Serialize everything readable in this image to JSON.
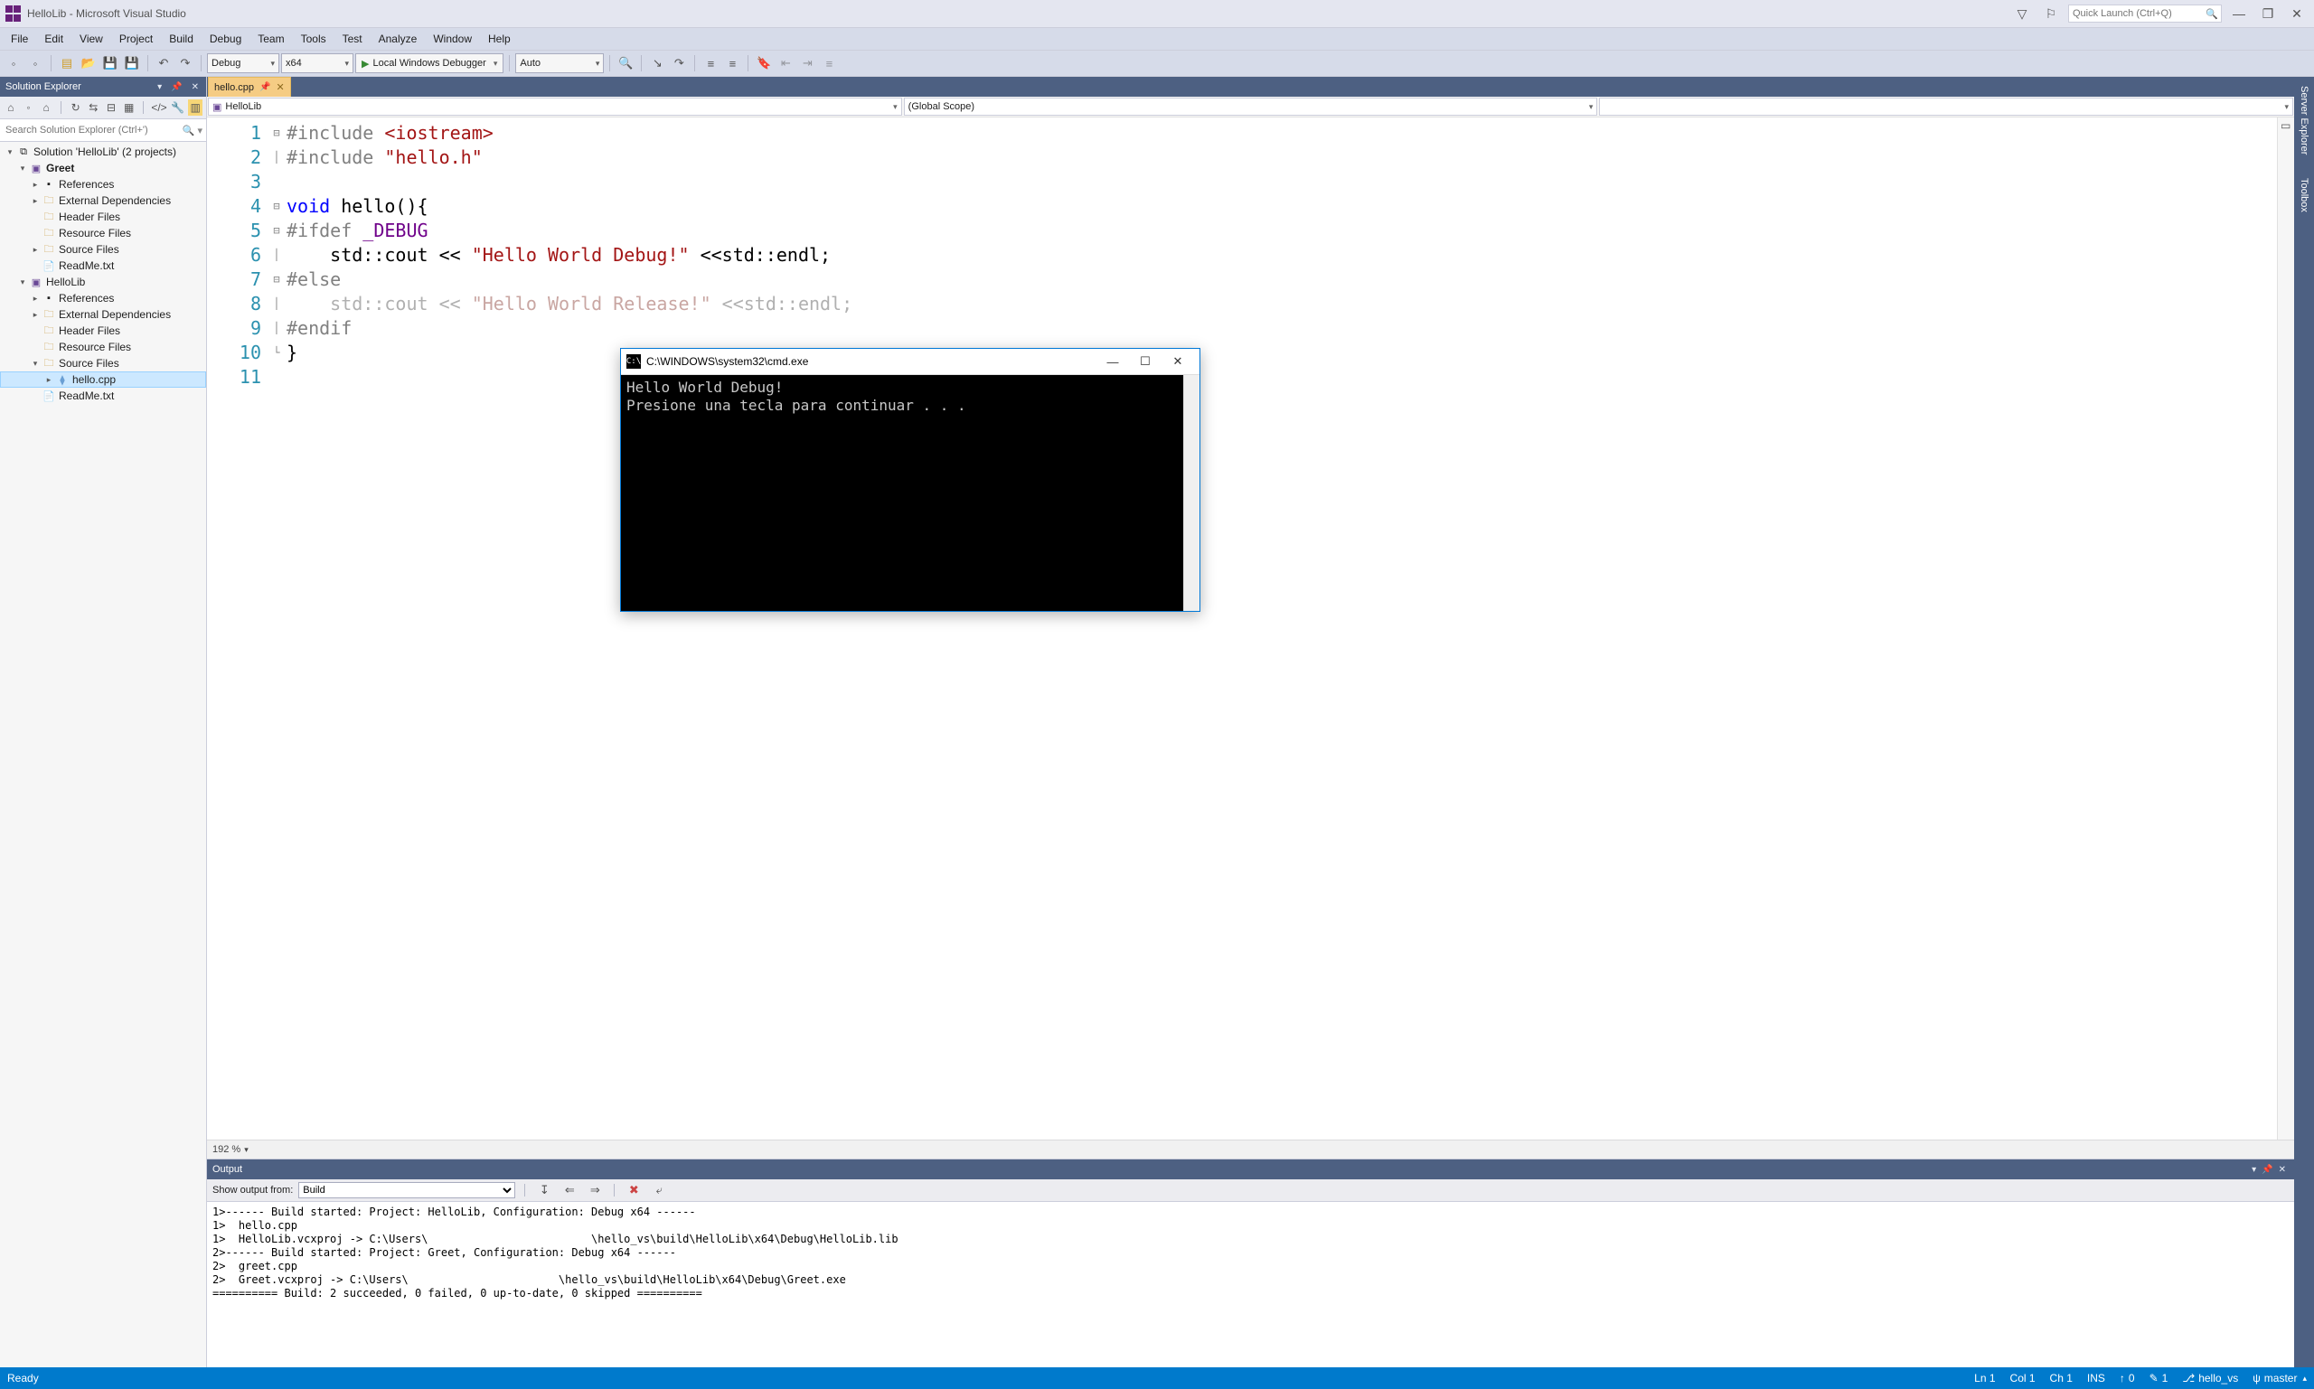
{
  "window": {
    "title": "HelloLib - Microsoft Visual Studio"
  },
  "quicklaunch": {
    "placeholder": "Quick Launch (Ctrl+Q)"
  },
  "menu": [
    "File",
    "Edit",
    "View",
    "Project",
    "Build",
    "Debug",
    "Team",
    "Tools",
    "Test",
    "Analyze",
    "Window",
    "Help"
  ],
  "toolbar": {
    "config": "Debug",
    "platform": "x64",
    "debugger": "Local Windows Debugger",
    "auto": "Auto"
  },
  "solution_explorer": {
    "title": "Solution Explorer",
    "search_placeholder": "Search Solution Explorer (Ctrl+')",
    "root": "Solution 'HelloLib' (2 projects)",
    "projects": [
      {
        "name": "Greet",
        "bold": true,
        "items": [
          "References",
          "External Dependencies",
          "Header Files",
          "Resource Files",
          "Source Files",
          "ReadMe.txt"
        ]
      },
      {
        "name": "HelloLib",
        "items": [
          "References",
          "External Dependencies",
          "Header Files",
          "Resource Files"
        ],
        "sources": {
          "folder": "Source Files",
          "files": [
            "hello.cpp"
          ],
          "after": [
            "ReadMe.txt"
          ]
        }
      }
    ]
  },
  "editor": {
    "tab": "hello.cpp",
    "nav_left": "HelloLib",
    "nav_right": "(Global Scope)",
    "zoom": "192 %",
    "lines": [
      1,
      2,
      3,
      4,
      5,
      6,
      7,
      8,
      9,
      10,
      11
    ],
    "code": {
      "l1_a": "#include",
      "l1_b": "<iostream>",
      "l2_a": "#include",
      "l2_b": "\"hello.h\"",
      "l4_a": "void",
      "l4_b": " hello(){",
      "l5_a": "#ifdef",
      "l5_b": "_DEBUG",
      "l6_b": "    std::cout << ",
      "l6_s": "\"Hello World Debug!\"",
      "l6_c": " <<std::endl;",
      "l7": "#else",
      "l8_b": "    std::cout << ",
      "l8_s": "\"Hello World Release!\"",
      "l8_c": " <<std::endl;",
      "l9": "#endif",
      "l10": "}"
    }
  },
  "right_tabs": [
    "Server Explorer",
    "Toolbox"
  ],
  "output": {
    "title": "Output",
    "show_from_label": "Show output from:",
    "show_from_value": "Build",
    "text": "1>------ Build started: Project: HelloLib, Configuration: Debug x64 ------\n1>  hello.cpp\n1>  HelloLib.vcxproj -> C:\\Users\\                         \\hello_vs\\build\\HelloLib\\x64\\Debug\\HelloLib.lib\n2>------ Build started: Project: Greet, Configuration: Debug x64 ------\n2>  greet.cpp\n2>  Greet.vcxproj -> C:\\Users\\                       \\hello_vs\\build\\HelloLib\\x64\\Debug\\Greet.exe\n========== Build: 2 succeeded, 0 failed, 0 up-to-date, 0 skipped =========="
  },
  "status": {
    "ready": "Ready",
    "ln": "Ln 1",
    "col": "Col 1",
    "ch": "Ch 1",
    "ins": "INS",
    "up": "0",
    "down": "1",
    "repo": "hello_vs",
    "branch": "master"
  },
  "console": {
    "title": "C:\\WINDOWS\\system32\\cmd.exe",
    "body": "Hello World Debug!\nPresione una tecla para continuar . . .\n"
  }
}
